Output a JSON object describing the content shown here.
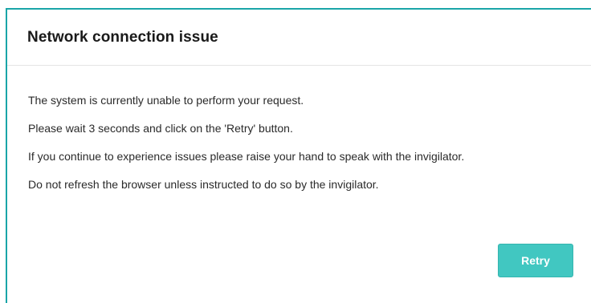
{
  "dialog": {
    "title": "Network connection issue",
    "messages": [
      "The system is currently unable to perform your request.",
      "Please wait 3 seconds and click on the 'Retry' button.",
      "If you continue to experience issues please raise your hand to speak with the invigilator.",
      "Do not refresh the browser unless instructed to do so by the invigilator."
    ],
    "retry_label": "Retry"
  },
  "colors": {
    "accent": "#1aa5a8",
    "button": "#41c7c1",
    "button_text": "#ffffff"
  }
}
